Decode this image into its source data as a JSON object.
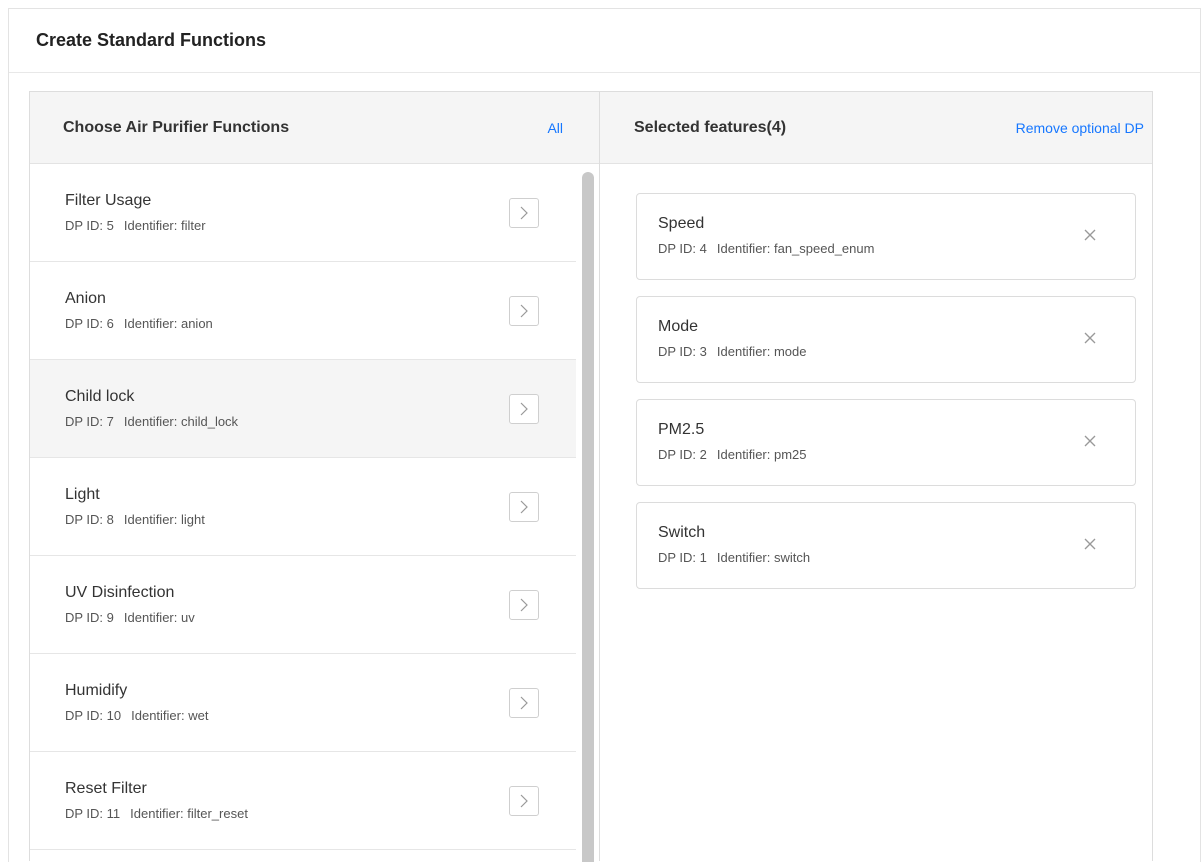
{
  "dialog": {
    "title": "Create Standard Functions"
  },
  "left_panel": {
    "title": "Choose Air Purifier Functions",
    "all_link": "All",
    "items": [
      {
        "name": "Filter Usage",
        "dp_id": "DP ID: 5",
        "identifier": "Identifier: filter"
      },
      {
        "name": "Anion",
        "dp_id": "DP ID: 6",
        "identifier": "Identifier: anion"
      },
      {
        "name": "Child lock",
        "dp_id": "DP ID: 7",
        "identifier": "Identifier: child_lock"
      },
      {
        "name": "Light",
        "dp_id": "DP ID: 8",
        "identifier": "Identifier: light"
      },
      {
        "name": "UV Disinfection",
        "dp_id": "DP ID: 9",
        "identifier": "Identifier: uv"
      },
      {
        "name": "Humidify",
        "dp_id": "DP ID: 10",
        "identifier": "Identifier: wet"
      },
      {
        "name": "Reset Filter",
        "dp_id": "DP ID: 11",
        "identifier": "Identifier: filter_reset"
      }
    ],
    "add_icon": "chevron-right-icon"
  },
  "right_panel": {
    "title": "Selected features(4)",
    "remove_link": "Remove optional DP",
    "items": [
      {
        "name": "Speed",
        "dp_id": "DP ID: 4",
        "identifier": "Identifier: fan_speed_enum"
      },
      {
        "name": "Mode",
        "dp_id": "DP ID: 3",
        "identifier": "Identifier: mode"
      },
      {
        "name": "PM2.5",
        "dp_id": "DP ID: 2",
        "identifier": "Identifier: pm25"
      },
      {
        "name": "Switch",
        "dp_id": "DP ID: 1",
        "identifier": "Identifier: switch"
      }
    ],
    "remove_icon": "close-icon"
  },
  "colors": {
    "link": "#1677ff",
    "hover_row": "#f5f5f5",
    "header_bg": "#f5f5f5",
    "border": "#dddddd"
  }
}
